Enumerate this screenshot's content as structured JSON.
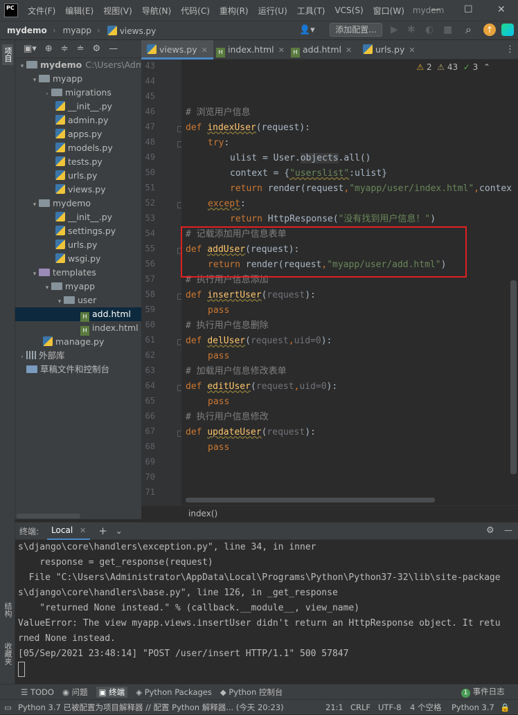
{
  "menubar": {
    "logo": "PC",
    "items": [
      "文件(F)",
      "编辑(E)",
      "视图(V)",
      "导航(N)",
      "代码(C)",
      "重构(R)",
      "运行(U)",
      "工具(T)",
      "VCS(S)",
      "窗口(W)"
    ],
    "project_title": "mydem",
    "minimize": "—",
    "maximize": "☐",
    "close": "✕"
  },
  "navbar": {
    "crumbs": [
      "mydemo",
      "myapp",
      "views.py"
    ],
    "add_config": "添加配置..."
  },
  "left_strip": {
    "project_tab": "项目",
    "structure_tab": "结构",
    "favorites_tab": "收藏夹"
  },
  "tree": {
    "root": "mydemo",
    "root_path": "C:\\Users\\Adm",
    "myapp": "myapp",
    "migrations": "migrations",
    "myapp_init": "__init__.py",
    "admin": "admin.py",
    "apps": "apps.py",
    "models": "models.py",
    "tests": "tests.py",
    "myapp_urls": "urls.py",
    "views": "views.py",
    "mydemo_pkg": "mydemo",
    "mydemo_init": "__init__.py",
    "settings": "settings.py",
    "mydemo_urls": "urls.py",
    "wsgi": "wsgi.py",
    "templates": "templates",
    "tpl_myapp": "myapp",
    "user": "user",
    "add_html": "add.html",
    "index_html": "index.html",
    "manage": "manage.py",
    "external_libs": "外部库",
    "scratches": "草稿文件和控制台"
  },
  "tabs": [
    "views.py",
    "index.html",
    "add.html",
    "urls.py"
  ],
  "inspection": {
    "warnings": "2",
    "weak_warnings": "43",
    "typos": "3"
  },
  "code": {
    "line_numbers": [
      "43",
      "44",
      "45",
      "46",
      "47",
      "48",
      "49",
      "50",
      "51",
      "52",
      "53",
      "54",
      "55",
      "56",
      "57",
      "58",
      "59",
      "60",
      "61",
      "62",
      "63",
      "64",
      "65",
      "66",
      "67",
      "68",
      "69",
      "70",
      "71"
    ],
    "l46": "# 浏览用户信息",
    "l47_def": "def ",
    "l47_fn": "indexUser",
    "l47_rest": "(request):",
    "l48_try": "try",
    "l48_colon": ":",
    "l49_a": "ulist = User.",
    "l49_b": "objects",
    "l49_c": ".all()",
    "l50_a": "context = {",
    "l50_b": "\"userslist\"",
    "l50_c": ":ulist}",
    "l51_ret": "return ",
    "l51_a": "render(request",
    "l51_b": ",",
    "l51_c": "\"myapp/user/index.html\"",
    "l51_d": ",",
    "l51_e": "contex",
    "l52_exc": "except",
    "l52_colon": ":",
    "l53_ret": "return ",
    "l53_a": "HttpResponse(",
    "l53_b": "\"没有找到用户信息！\"",
    "l53_c": ")",
    "l54": "# 记载添加用户信息表单",
    "l55_def": "def ",
    "l55_fn": "addUser",
    "l55_rest": "(request):",
    "l56_ret": "return ",
    "l56_a": "render(request",
    "l56_b": ",",
    "l56_c": "\"myapp/user/add.html\"",
    "l56_d": ")",
    "l57": "# 执行用户信息添加",
    "l58_def": "def ",
    "l58_fn": "insertUser",
    "l58_p1": "(",
    "l58_p2": "request",
    "l58_p3": "):",
    "pass": "pass",
    "l60": "# 执行用户信息删除",
    "l61_def": "def ",
    "l61_fn": "delUser",
    "l61_p1": "(",
    "l61_p2": "request",
    "l61_p3": ",",
    "l61_p4": "uid=0",
    "l61_p5": "):",
    "l63": "# 加载用户信息修改表单",
    "l64_def": "def ",
    "l64_fn": "editUser",
    "l64_p1": "(",
    "l64_p2": "request",
    "l64_p3": ",",
    "l64_p4": "uid=0",
    "l64_p5": "):",
    "l66": "# 执行用户信息修改",
    "l67_def": "def ",
    "l67_fn": "updateUser",
    "l67_p1": "(",
    "l67_p2": "request",
    "l67_p3": "):"
  },
  "editor_breadcrumb": "index()",
  "terminal": {
    "title": "终端:",
    "tab": "Local",
    "lines": [
      "s\\django\\core\\handlers\\exception.py\", line 34, in inner",
      "    response = get_response(request)",
      "  File \"C:\\Users\\Administrator\\AppData\\Local\\Programs\\Python\\Python37-32\\lib\\site-package",
      "s\\django\\core\\handlers\\base.py\", line 126, in _get_response",
      "    \"returned None instead.\" % (callback.__module__, view_name)",
      "ValueError: The view myapp.views.insertUser didn't return an HttpResponse object. It retu",
      "rned None instead.",
      "[05/Sep/2021 23:48:14] \"POST /user/insert HTTP/1.1\" 500 57847"
    ]
  },
  "bottom_tools": [
    "TODO",
    "问题",
    "终端",
    "Python Packages",
    "Python 控制台"
  ],
  "event_log": "事件日志",
  "event_count": "1",
  "status": {
    "message": "Python 3.7 已被配置为项目解释器 // 配置 Python 解释器... (今天 20:23)",
    "position": "21:1",
    "line_sep": "CRLF",
    "encoding": "UTF-8",
    "indent": "4 个空格",
    "interpreter": "Python 3.7"
  }
}
